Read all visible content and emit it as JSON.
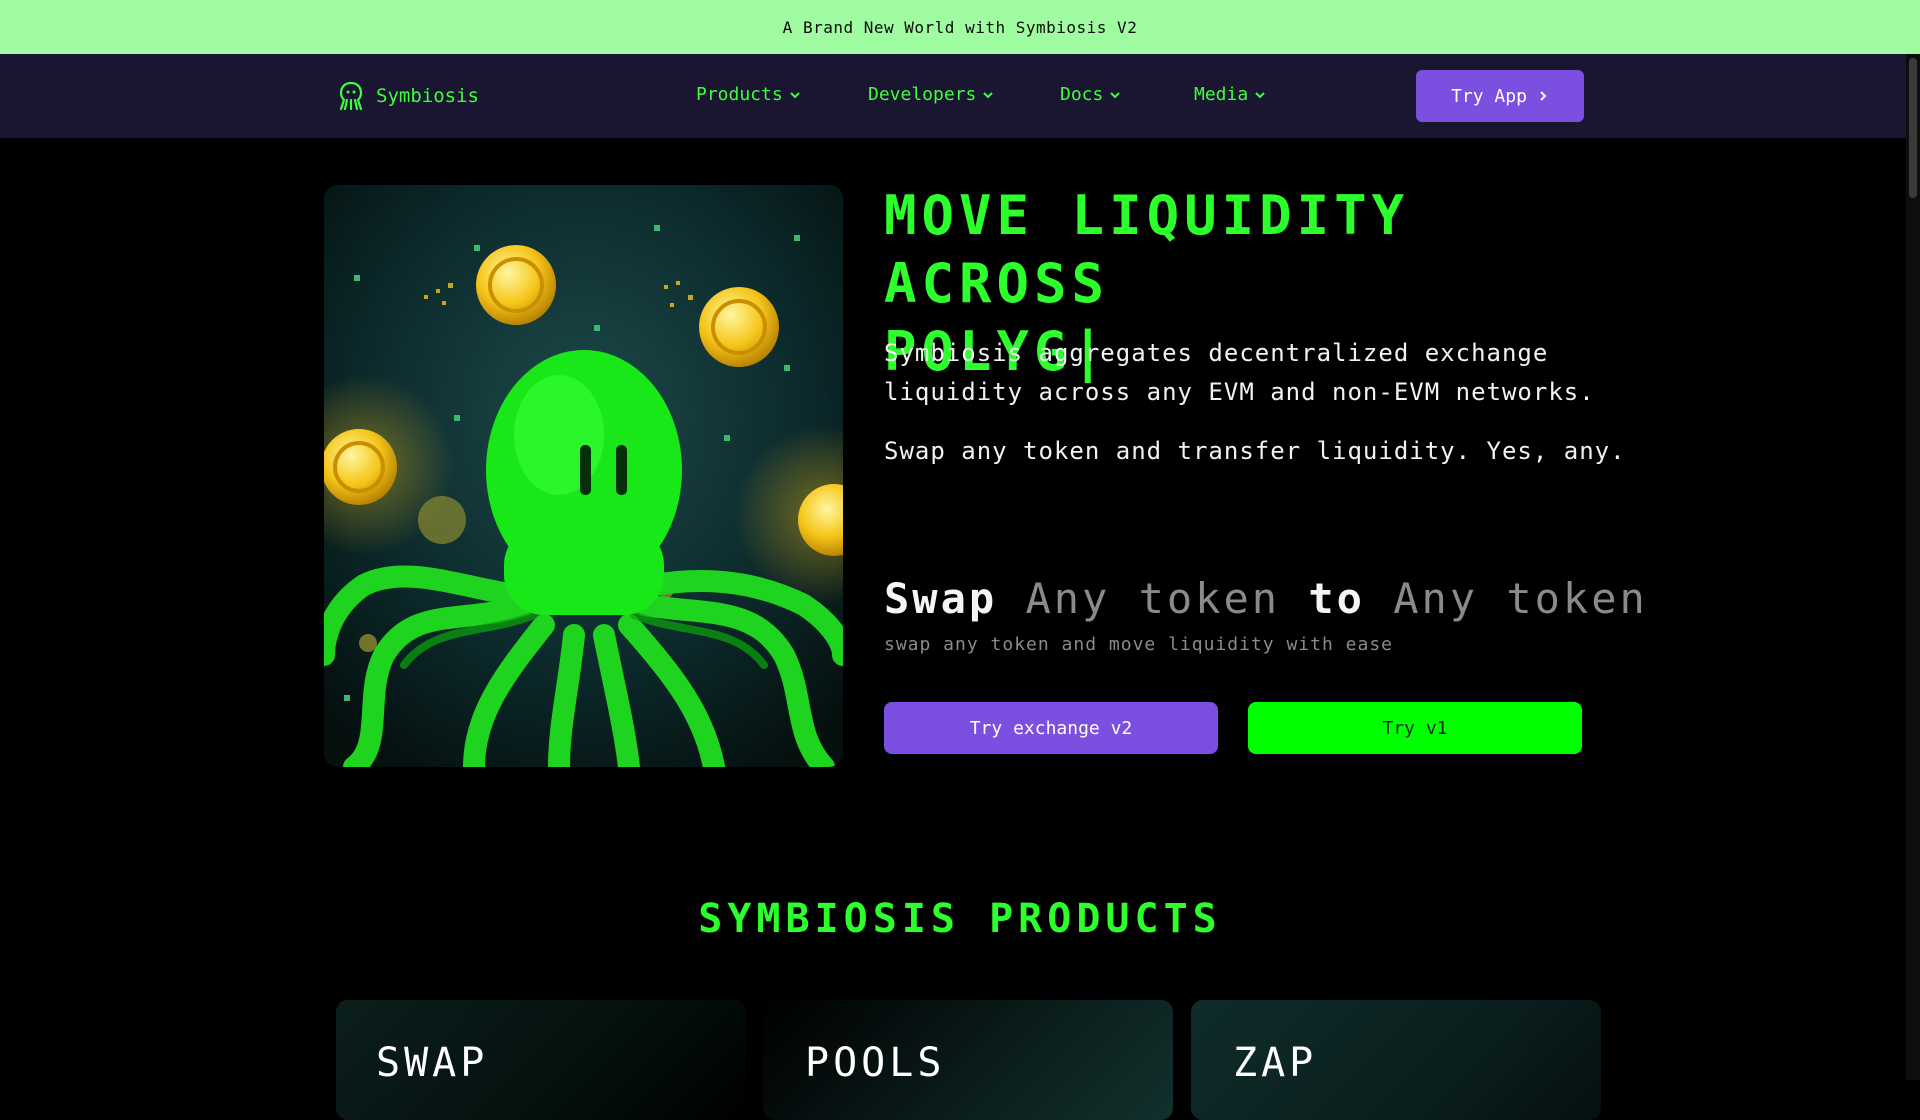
{
  "banner": {
    "text": "A Brand New World with Symbiosis V2"
  },
  "nav": {
    "logo_text": "Symbiosis",
    "links": [
      {
        "label": "Products"
      },
      {
        "label": "Developers"
      },
      {
        "label": "Docs"
      },
      {
        "label": "Media"
      }
    ],
    "cta_label": "Try App"
  },
  "hero": {
    "title_line1": "MOVE LIQUIDITY ACROSS",
    "title_line2": "POLYG|",
    "desc1_line1": "Symbiosis aggregates decentralized exchange",
    "desc1_line2": "liquidity across any EVM and non-EVM networks.",
    "desc2": "Swap any token and transfer liquidity. Yes, any.",
    "swap_word": "Swap",
    "any_token_1": "Any token",
    "to_word": "to",
    "any_token_2": "Any token",
    "swap_sub": "swap any token and move liquidity with ease",
    "btn_v2": "Try exchange v2",
    "btn_v1": "Try v1"
  },
  "products": {
    "title": "SYMBIOSIS PRODUCTS",
    "cards": [
      {
        "label": "SWAP"
      },
      {
        "label": "POOLS"
      },
      {
        "label": "ZAP"
      }
    ]
  },
  "colors": {
    "accent_green": "#2cff2c",
    "accent_purple": "#7b4fe0",
    "banner_bg": "#a0fca0",
    "nav_bg": "#1a1530"
  }
}
